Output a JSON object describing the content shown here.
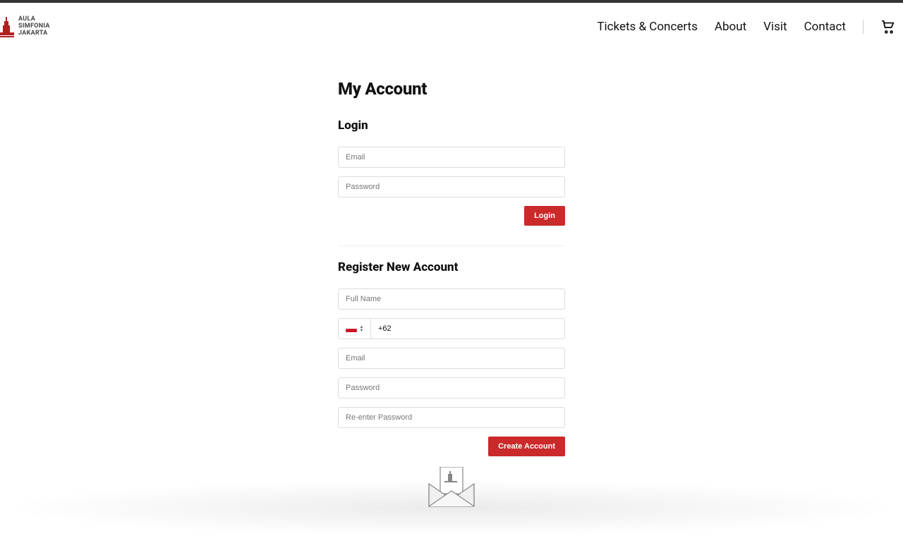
{
  "logo": {
    "line1": "AULA",
    "line2": "SIMFONIA",
    "line3": "JAKARTA"
  },
  "nav": {
    "tickets": "Tickets & Concerts",
    "about": "About",
    "visit": "Visit",
    "contact": "Contact"
  },
  "page": {
    "title": "My Account"
  },
  "login": {
    "heading": "Login",
    "email_ph": "Email",
    "password_ph": "Password",
    "button": "Login"
  },
  "register": {
    "heading": "Register New Account",
    "fullname_ph": "Full Name",
    "phone_value": "+62",
    "email_ph": "Email",
    "password_ph": "Password",
    "repassword_ph": "Re-enter Password",
    "button": "Create Account"
  }
}
